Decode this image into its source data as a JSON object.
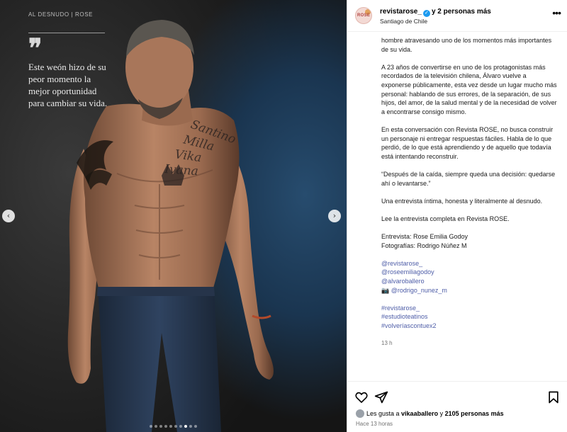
{
  "post_image": {
    "kicker": "AL DESNUDO | ROSE",
    "quote_mark": "❞",
    "quote": "Este weón hizo de su peor momento la mejor oportunidad para cambiar su vida.",
    "tattoo_text": "Santino Milla Vika Ivana",
    "slide_count": 10,
    "active_slide": 8,
    "prev_label": "‹",
    "next_label": "›"
  },
  "header": {
    "username": "revistarose_",
    "verified_icon": "✓",
    "others": "y 2 personas más",
    "location": "Santiago de Chile",
    "avatar_text": "ROSE",
    "more_label": "•••"
  },
  "caption": {
    "intro_tail": "hombre atravesando uno de los momentos más importantes de su vida.",
    "p1": "A 23 años de convertirse en uno de los protagonistas más recordados de la televisión chilena, Álvaro vuelve a exponerse públicamente, esta vez desde un lugar mucho más personal: hablando de sus errores, de la separación, de sus hijos, del amor, de la salud mental y de la necesidad de volver a encontrarse consigo mismo.",
    "p2": "En esta conversación con Revista ROSE, no busca construir un personaje ni entregar respuestas fáciles. Habla de lo que perdió, de lo que está aprendiendo y de aquello que todavía está intentando reconstruir.",
    "p3": "“Después de la caída, siempre queda una decisión: quedarse ahí o levantarse.”",
    "p4": "Una entrevista íntima, honesta y literalmente al desnudo.",
    "p5": "Lee la entrevista completa en Revista ROSE.",
    "credit1": "Entrevista: Rose Emilia Godoy",
    "credit2": "Fotografías: Rodrigo Núñez M",
    "mentions": [
      "@revistarose_",
      "@roseemiliagodoy",
      "@alvaroballero",
      "📷 @rodrigo_nunez_m"
    ],
    "hashtags": [
      "#revistarose_",
      "#estudioteatinos",
      "#volveríascontuex2"
    ],
    "time": "13 h"
  },
  "footer": {
    "likes_prefix": "Les gusta a ",
    "liker": "vikaaballero",
    "likes_mid": " y ",
    "likes_count": "2105 personas más",
    "posted": "Hace 13 horas"
  }
}
